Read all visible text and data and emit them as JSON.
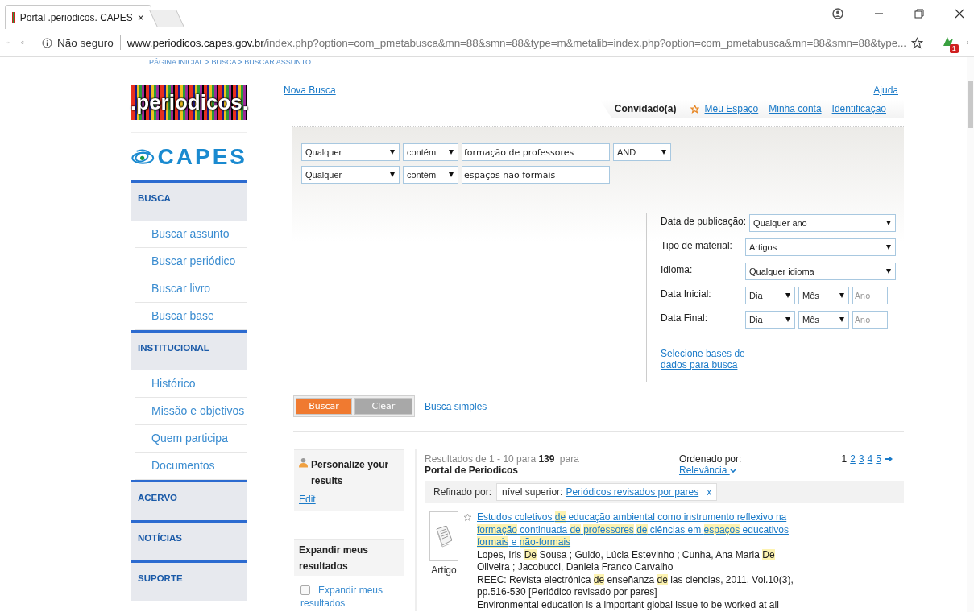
{
  "browser": {
    "tab": {
      "title": "Portal .periodicos. CAPES",
      "close": "×"
    },
    "address": {
      "security": "Não seguro",
      "host": "www.periodicos.capes.gov.br",
      "path": "/index.php?option=com_pmetabusca&mn=88&smn=88&type=m&metalib=index.php?option=com_pmetabusca&mn=88&smn=88&type..."
    },
    "extension_badge": "1"
  },
  "breadcrumb": "PÁGINA INICIAL > BUSCA > BUSCAR ASSUNTO",
  "logo": {
    "periodicos": ".periodicos.",
    "capes": "CAPES"
  },
  "sidebar": [
    {
      "title": "BUSCA",
      "items": [
        "Buscar assunto",
        "Buscar periódico",
        "Buscar livro",
        "Buscar base"
      ]
    },
    {
      "title": "INSTITUCIONAL",
      "items": [
        "Histórico",
        "Missão e objetivos",
        "Quem participa",
        "Documentos"
      ]
    },
    {
      "title": "ACERVO"
    },
    {
      "title": "NOTÍCIAS"
    },
    {
      "title": "SUPORTE"
    }
  ],
  "top": {
    "nova_busca": "Nova Busca",
    "ajuda": "Ajuda",
    "user": "Convidado(a)",
    "links": [
      "Meu Espaço",
      "Minha conta",
      "Identificação"
    ]
  },
  "search_rows": [
    {
      "field": "Qualquer",
      "operator": "contém",
      "value": "formação de professores",
      "boolean": "AND"
    },
    {
      "field": "Qualquer",
      "operator": "contém",
      "value": "espaços não formais"
    }
  ],
  "filters": [
    {
      "kind": "select",
      "label": "Data de publicação:",
      "value": "Qualquer ano"
    },
    {
      "kind": "select",
      "label": "Tipo de material:",
      "value": "Artigos"
    },
    {
      "kind": "select",
      "label": "Idioma:",
      "value": "Qualquer idioma"
    },
    {
      "kind": "date",
      "label": "Data Inicial:",
      "day": "Dia",
      "month": "Mês",
      "year_placeholder": "Ano"
    },
    {
      "kind": "date",
      "label": "Data Final:",
      "day": "Dia",
      "month": "Mês",
      "year_placeholder": "Ano"
    }
  ],
  "bases_link": "Selecione bases de dados para busca",
  "buttons": {
    "search": "Buscar",
    "clear": "Clear",
    "simple": "Busca simples"
  },
  "personalize": {
    "title": "Personalize your results",
    "edit": "Edit"
  },
  "expand": {
    "title": "Expandir meus resultados",
    "checkbox_label": "Expandir meus resultados",
    "checked": false
  },
  "results": {
    "summary": "Resultados de 1 - 10 para **139** para",
    "source": "Portal de Periodicos",
    "sort_label": "Ordenado por:",
    "sort": "Relevância",
    "pages": [
      {
        "label": "1",
        "selected": true
      },
      {
        "label": "2",
        "selected": false
      },
      {
        "label": "3",
        "selected": false
      },
      {
        "label": "4",
        "selected": false
      },
      {
        "label": "5",
        "selected": false
      }
    ],
    "refine_label": "Refinado por:",
    "refine_prefix": "nível superior:",
    "refine_value": "Periódicos revisados por pares",
    "refine_remove": "x",
    "items": [
      {
        "type": "Artigo",
        "title": "Estudos coletivos **de** educação ambiental como instrumento reflexivo na **formação** continuada **de** **professores** **de** ciências em **espaços** educativos **formais** e **não-formais**",
        "authors": "Lopes, Iris **De** Sousa ; Guido, Lúcia Estevinho ; Cunha, Ana Maria **De** Oliveira ; Jacobucci, Daniela Franco Carvalho",
        "source": "REEC: Revista electrónica **de** enseñanza **de** las ciencias, 2011, Vol.10(3), pp.516-530 [Periódico revisado por pares]",
        "abstract": "Environmental education is a important global issue to be worked at all"
      }
    ]
  }
}
